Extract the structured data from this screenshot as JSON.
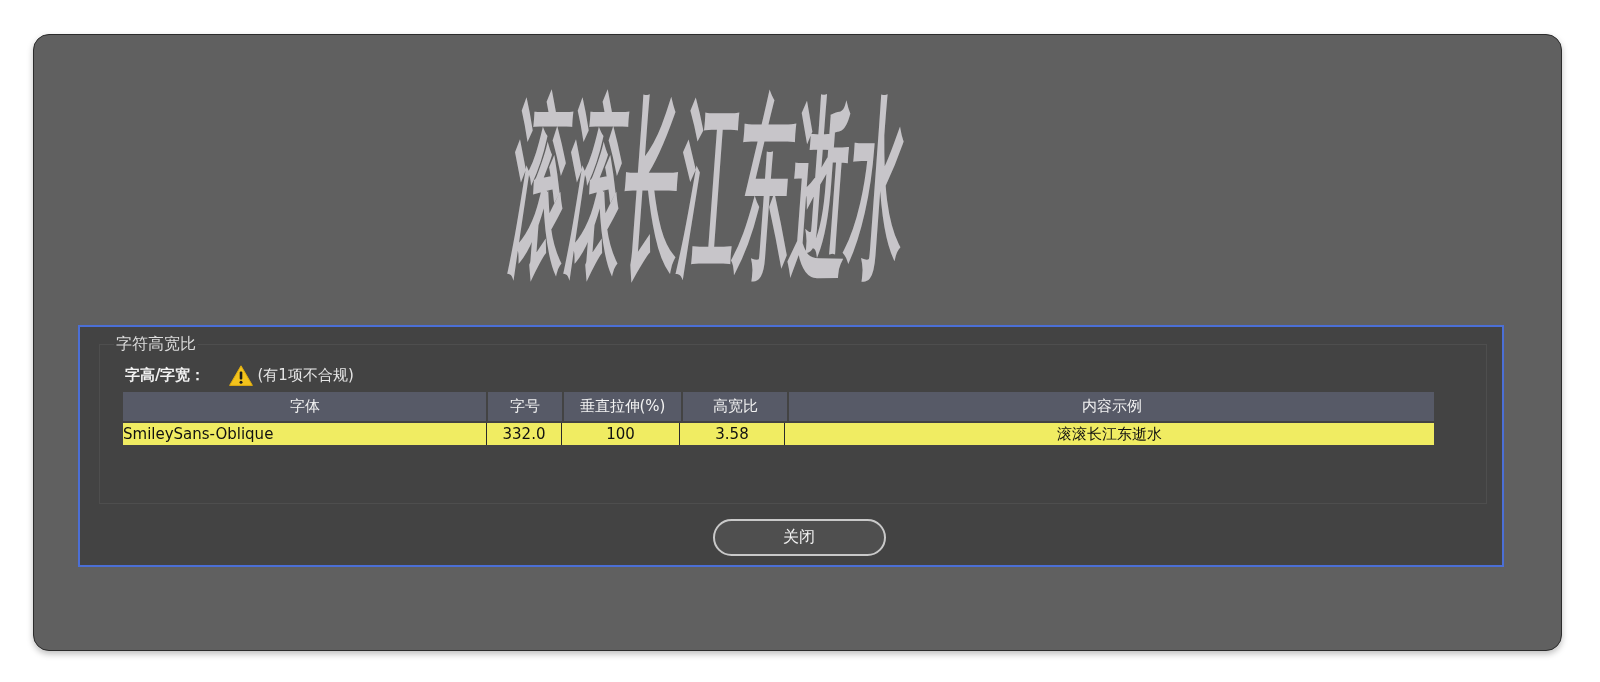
{
  "preview": {
    "text": "滚滚长江东逝水"
  },
  "dialog": {
    "group_title": "字符高宽比",
    "status": {
      "label": "字高/字宽：",
      "warning": "(有1项不合规)"
    },
    "table": {
      "columns": [
        "字体",
        "字号",
        "垂直拉伸(%)",
        "高宽比",
        "内容示例"
      ],
      "rows": [
        {
          "cells": [
            "SmileySans-Oblique",
            "332.0",
            "100",
            "3.58",
            "滚滚长江东逝水"
          ],
          "flagged": true
        }
      ]
    },
    "buttons": [
      "关闭"
    ]
  }
}
